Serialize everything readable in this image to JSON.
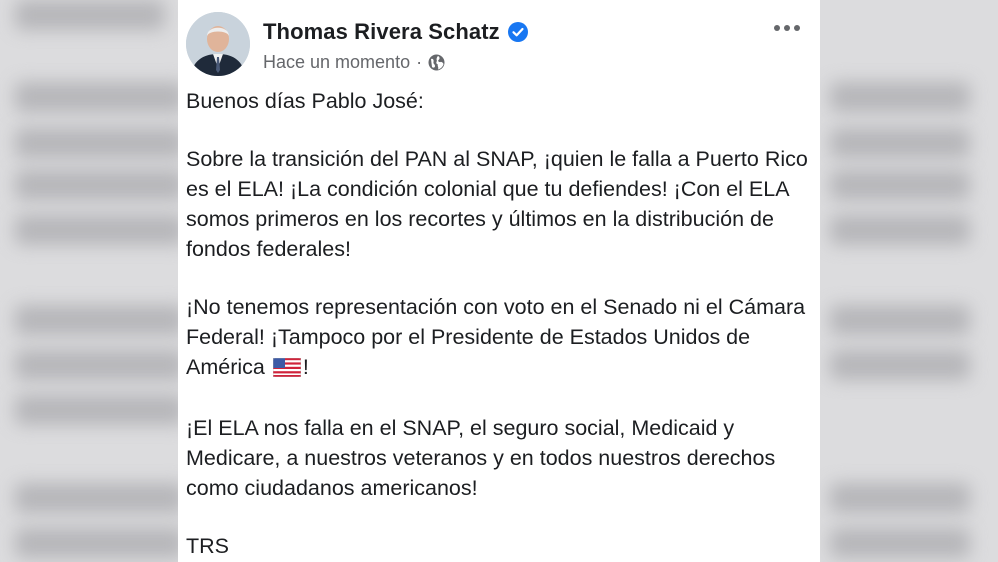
{
  "post": {
    "author": "Thomas Rivera Schatz",
    "timestamp": "Hace un momento",
    "meta_separator": "·",
    "verified_icon": "verified-badge-icon",
    "privacy_icon": "globe-icon",
    "more_icon": "more-options-icon",
    "paragraphs": [
      "Buenos días Pablo José:",
      "Sobre la transición del PAN al SNAP, ¡quien le falla a Puerto Rico es el ELA! ¡La condición colonial que tu defiendes! ¡Con el ELA somos primeros en los recortes y últimos en la distribución de fondos federales!",
      "¡No tenemos representación con voto en el Senado ni el Cámara Federal! ¡Tampoco por el Presidente de Estados Unidos de América",
      "¡El ELA nos falla en el SNAP, el seguro social, Medicaid y Medicare, a nuestros veteranos y en todos nuestros derechos como ciudadanos americanos!",
      "TRS"
    ],
    "paragraph3_suffix": "!",
    "flag_icon": "us-flag-emoji-icon"
  },
  "colors": {
    "text": "#1c1e21",
    "secondary_text": "#65676b",
    "verified_blue": "#1877f2",
    "card_bg": "#ffffff",
    "backdrop": "#dcdcde"
  }
}
